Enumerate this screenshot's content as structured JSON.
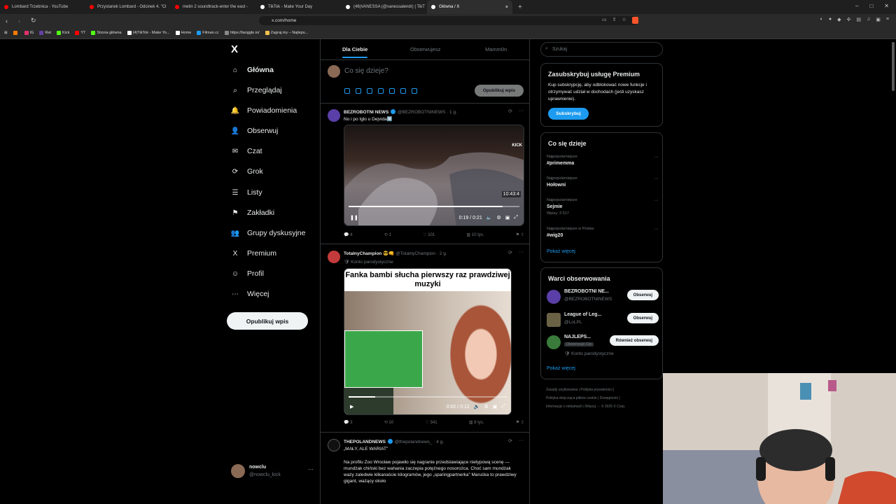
{
  "browser": {
    "tabs": [
      {
        "title": "Lombard Trzebnica - YouTube",
        "color": "#ff0000"
      },
      {
        "title": "Przystanek Lombard - Odcinek 4. \"Cl",
        "color": "#ff0000"
      },
      {
        "title": "metin 2 soundtrack-enter the east -",
        "color": "#ff0000"
      },
      {
        "title": "TikTok - Make Your Day",
        "color": "#ffffff"
      },
      {
        "title": "(46)VANESSA (@vanessalendr) | TikT",
        "color": "#ffffff"
      },
      {
        "title": "Główna / X",
        "color": "#ffffff",
        "active": true,
        "close": "×"
      }
    ],
    "new_tab": "+",
    "window": {
      "min": "–",
      "max": "□",
      "close": "✕"
    },
    "nav": {
      "back": "‹",
      "forward": "›",
      "reload": "↻"
    },
    "url": "x.com/home",
    "bookmarks": [
      {
        "label": "",
        "color": "#f57c00"
      },
      {
        "label": "IG",
        "color": "#e1306c"
      },
      {
        "label": "Rat",
        "color": "#6441a5"
      },
      {
        "label": "Kick",
        "color": "#53fc18"
      },
      {
        "label": "YT",
        "color": "#ff0000"
      },
      {
        "label": "Strona główna",
        "color": "#53fc18"
      },
      {
        "label": "(4)TikTok - Make Yo...",
        "color": "#ffffff"
      },
      {
        "label": "Home",
        "color": "#ffffff"
      },
      {
        "label": "Filman.cc",
        "color": "#1d9bf0"
      },
      {
        "label": "https://tanggle.io/",
        "color": "#888888"
      },
      {
        "label": "Zagraj.my – Najleps...",
        "color": "#f2c14e"
      }
    ]
  },
  "nav": {
    "logo": "X",
    "items": [
      {
        "label": "Główna",
        "icon": "home-icon",
        "glyph": "⌂",
        "active": true
      },
      {
        "label": "Przeglądaj",
        "icon": "search-icon",
        "glyph": "⌕"
      },
      {
        "label": "Powiadomienia",
        "icon": "bell-icon",
        "glyph": "🔔"
      },
      {
        "label": "Obserwuj",
        "icon": "follow-icon",
        "glyph": "👤"
      },
      {
        "label": "Czat",
        "icon": "mail-icon",
        "glyph": "✉"
      },
      {
        "label": "Grok",
        "icon": "grok-icon",
        "glyph": "⟳"
      },
      {
        "label": "Listy",
        "icon": "list-icon",
        "glyph": "☰"
      },
      {
        "label": "Zakładki",
        "icon": "bookmark-icon",
        "glyph": "⚑"
      },
      {
        "label": "Grupy dyskusyjne",
        "icon": "communities-icon",
        "glyph": "👥"
      },
      {
        "label": "Premium",
        "icon": "x-premium-icon",
        "glyph": "X"
      },
      {
        "label": "Profil",
        "icon": "profile-icon",
        "glyph": "☺"
      },
      {
        "label": "Więcej",
        "icon": "more-icon",
        "glyph": "⋯"
      }
    ],
    "post_button": "Opublikuj wpis",
    "account": {
      "name": "nowclu",
      "handle": "@nowclu_kick",
      "more": "···"
    }
  },
  "feed": {
    "tabs": [
      "Dla Ciebie",
      "Obserwujesz",
      "Mamm0n"
    ],
    "composer": {
      "placeholder": "Co się dzieje?",
      "post": "Opublikuj wpis"
    },
    "tweets": [
      {
        "name": "BEZROBOTNI NEWS",
        "handle": "@BEZROBOTNINEWS · 1 g.",
        "text": "No i po Iglo u Dejvida🔟",
        "video": {
          "time": "0:19 / 0:21",
          "badge": "10:43:4",
          "progress": 0.9
        },
        "actions": {
          "replies": "4",
          "reposts": "1",
          "likes": "101",
          "views": "10 tys."
        }
      },
      {
        "name": "TotalnyChampion 😎👊",
        "handle": "@TotalnyChampion · 2 g.",
        "parody": "Konto parodystyczne",
        "caption": "Fanka bambi słucha pierwszy raz prawdziwej muzyki",
        "video": {
          "time": "0:02 / 0:12",
          "progress": 0.17
        },
        "actions": {
          "replies": "3",
          "reposts": "10",
          "likes": "341",
          "views": "8 tys."
        }
      },
      {
        "name": "THEPOLANDNEWS",
        "handle": "@thepolandnews_ · 4 g.",
        "title": "„MAŁY, ALE WARIAT”",
        "text": "Na profilu Zoo Wrocław pojawiło się nagranie przedstawiające nietypową scenę — mundżak chiński bez wahania zaczepia potężnego nosorożca. Choć sam mundżak waży zaledwie kilkanaście kilogramów, jego „sparingpartnerka” Maruśka to prawdziwy gigant, ważący około"
      }
    ]
  },
  "right": {
    "search_placeholder": "Szukaj",
    "premium": {
      "title": "Zasubskrybuj usługę Premium",
      "text": "Kup subskrypcję, aby odblokować nowe funkcje i otrzymywać udział w dochodach (jeśli uzyskasz uprawnienie).",
      "button": "Subskrybuj"
    },
    "trends": {
      "title": "Co się dzieje",
      "items": [
        {
          "cat": "Najpopularniejsze",
          "name": "#primemma"
        },
        {
          "cat": "Najpopularniejsze",
          "name": "Hołowni"
        },
        {
          "cat": "Najpopularniejsze",
          "name": "Sejmie",
          "sub": "Wpisy: 3 517"
        },
        {
          "cat": "Najpopularniejsze w Polska",
          "name": "#wig20"
        }
      ],
      "more": "Pokaż więcej"
    },
    "who": {
      "title": "Warci obserwowania",
      "items": [
        {
          "name": "BEZROBOTNI NE...",
          "handle": "@BEZROBOTNINEWS",
          "button": "Obserwuj"
        },
        {
          "name": "League of Leg...",
          "handle": "@LoLPL",
          "button": "Obserwuj"
        },
        {
          "name": "NAJLEPS...",
          "handle": "Obserwuje Cię",
          "parody": "Konto parodystyczne",
          "button": "Również obserwuj"
        }
      ],
      "more": "Pokaż więcej"
    },
    "footer": [
      "Zasady użytkowania",
      "Polityka prywatności",
      "Polityka dotycząca plików cookie",
      "Dostępność",
      "Informacje o reklamach",
      "Więcej ···",
      "© 2025 X Corp."
    ]
  }
}
